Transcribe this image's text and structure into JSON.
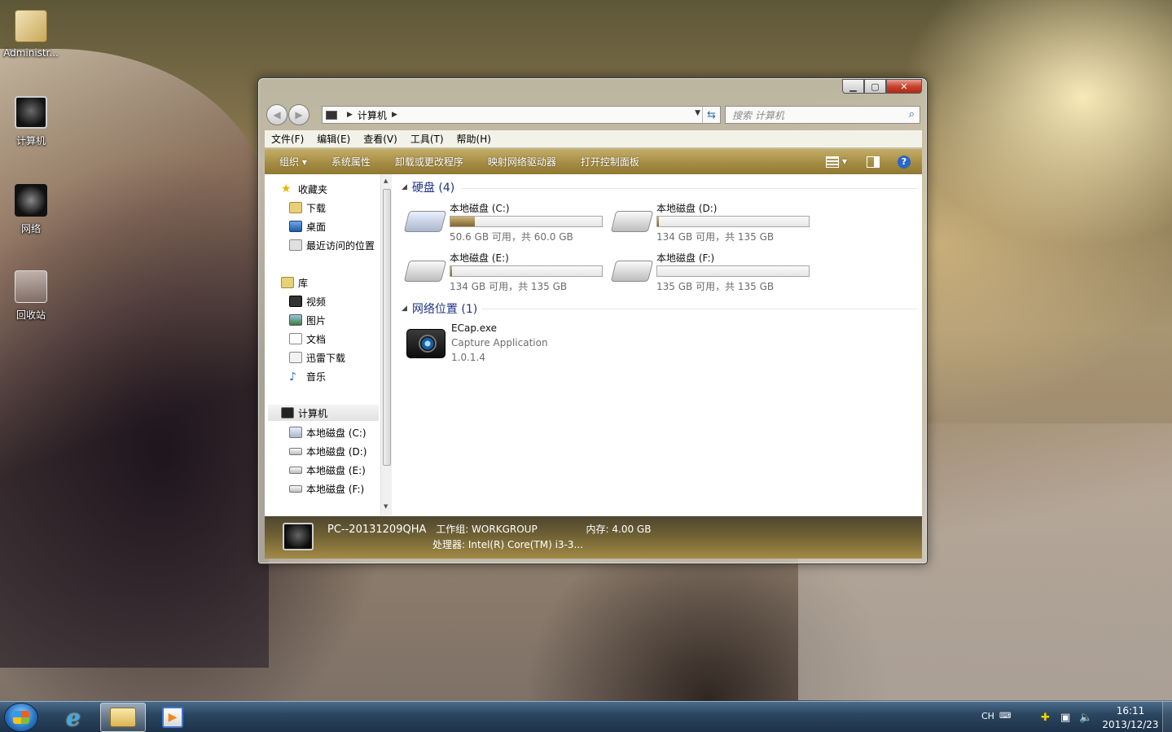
{
  "desktop": {
    "icons": [
      {
        "label": "Administr..."
      },
      {
        "label": "计算机"
      },
      {
        "label": "网络"
      },
      {
        "label": "回收站"
      }
    ]
  },
  "window": {
    "title_buttons": {
      "minimize": "▁",
      "maximize": "▢",
      "close": "✕"
    },
    "address": {
      "crumb": "计算机"
    },
    "search": {
      "placeholder": "搜索 计算机"
    },
    "menu": [
      "文件(F)",
      "编辑(E)",
      "查看(V)",
      "工具(T)",
      "帮助(H)"
    ],
    "commands": [
      "组织 ▾",
      "系统属性",
      "卸载或更改程序",
      "映射网络驱动器",
      "打开控制面板"
    ],
    "nav": {
      "favorites": "收藏夹",
      "fav_items": [
        "下载",
        "桌面",
        "最近访问的位置"
      ],
      "libraries": "库",
      "lib_items": [
        "视频",
        "图片",
        "文档",
        "迅雷下载",
        "音乐"
      ],
      "computer": "计算机",
      "drives": [
        "本地磁盘 (C:)",
        "本地磁盘 (D:)",
        "本地磁盘 (E:)",
        "本地磁盘 (F:)"
      ]
    },
    "groups": {
      "hard_disks": "硬盘 (4)",
      "network": "网络位置 (1)"
    },
    "drives": [
      {
        "name": "本地磁盘 (C:)",
        "size": "50.6 GB 可用，共 60.0 GB",
        "used_fraction": 0.16
      },
      {
        "name": "本地磁盘 (D:)",
        "size": "134 GB 可用，共 135 GB",
        "used_fraction": 0.01
      },
      {
        "name": "本地磁盘 (E:)",
        "size": "134 GB 可用，共 135 GB",
        "used_fraction": 0.01
      },
      {
        "name": "本地磁盘 (F:)",
        "size": "135 GB 可用，共 135 GB",
        "used_fraction": 0.0
      }
    ],
    "network_item": {
      "name": "ECap.exe",
      "desc": "Capture Application",
      "version": "1.0.1.4"
    },
    "details": {
      "pc_name": "PC--20131209QHA",
      "workgroup": "工作组: WORKGROUP",
      "memory": "内存: 4.00 GB",
      "processor": "处理器: Intel(R) Core(TM) i3-3..."
    }
  },
  "taskbar": {
    "lang": "CH",
    "time": "16:11",
    "date": "2013/12/23"
  },
  "colors": {
    "command_bar": "#a68d43",
    "group_heading": "#1e3287",
    "taskbar": "#2c4761"
  }
}
